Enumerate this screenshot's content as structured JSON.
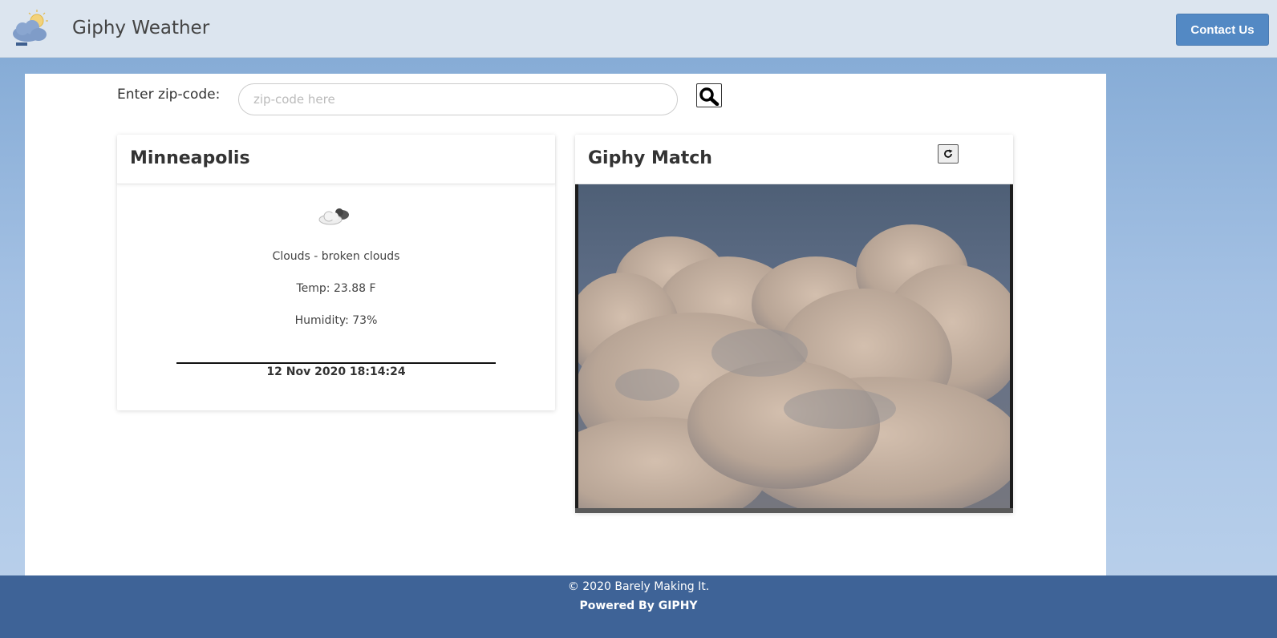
{
  "navbar": {
    "brand": "Giphy Weather",
    "logo_icon": "cloud-sun-logo-icon",
    "contact_label": "Contact Us"
  },
  "search": {
    "label": "Enter zip-code:",
    "placeholder": "zip-code here",
    "value": "",
    "button_icon": "search-icon"
  },
  "weather": {
    "city": "Minneapolis",
    "icon": "broken-clouds-icon",
    "description": "Clouds - broken clouds",
    "temp": "Temp: 23.88 F",
    "humidity": "Humidity: 73%",
    "timestamp": "12 Nov 2020 18:14:24"
  },
  "giphy": {
    "title": "Giphy Match",
    "refresh_icon": "refresh-icon",
    "image": "clouds-gif-image"
  },
  "footer": {
    "copyright": "© 2020 Barely Making It.",
    "powered": "Powered By GIPHY"
  },
  "colors": {
    "navbar_bg": "#dce5ef",
    "contact_button": "#5389c4",
    "footer_bg": "#3e6397"
  }
}
